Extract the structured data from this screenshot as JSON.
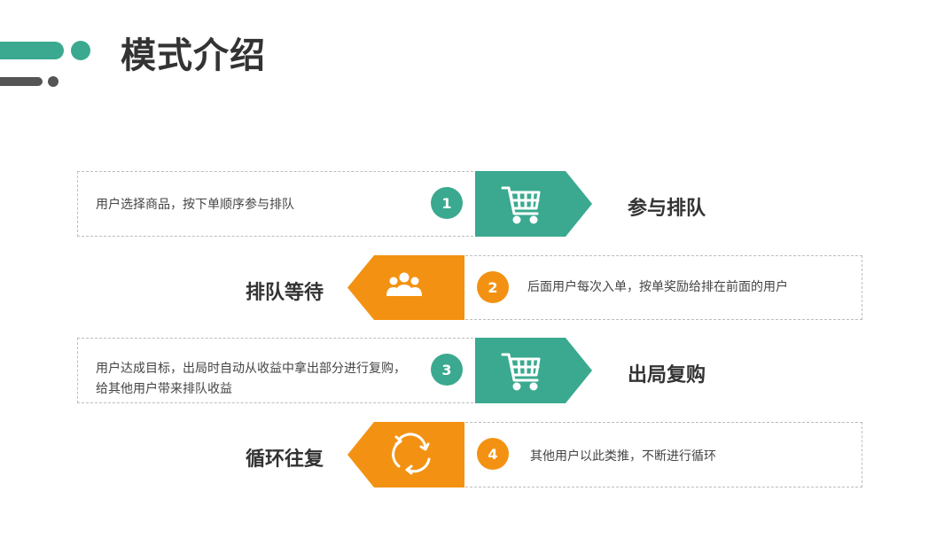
{
  "page": {
    "title": "模式介绍"
  },
  "colors": {
    "teal": "#3aa98f",
    "orange": "#f39212",
    "text": "#333333"
  },
  "steps": [
    {
      "number": "1",
      "title": "参与排队",
      "description": "用户选择商品，按下单顺序参与排队",
      "icon": "shopping-cart-icon",
      "color": "teal"
    },
    {
      "number": "2",
      "title": "排队等待",
      "description": "后面用户每次入单，按单奖励给排在前面的用户",
      "icon": "group-users-icon",
      "color": "orange"
    },
    {
      "number": "3",
      "title": "出局复购",
      "description": "用户达成目标，出局时自动从收益中拿出部分进行复购，给其他用户带来排队收益",
      "icon": "shopping-cart-icon",
      "color": "teal"
    },
    {
      "number": "4",
      "title": "循环往复",
      "description": "其他用户以此类推，不断进行循环",
      "icon": "recycle-arrows-icon",
      "color": "orange"
    }
  ]
}
